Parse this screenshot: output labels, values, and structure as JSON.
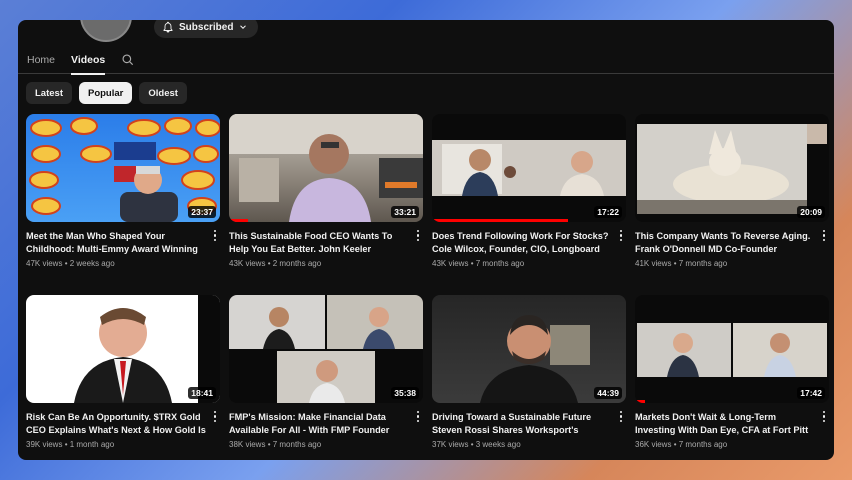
{
  "channel": {
    "subscribe_label": "Subscribed"
  },
  "tabs": [
    {
      "label": "Home"
    },
    {
      "label": "Videos"
    }
  ],
  "chips": [
    {
      "label": "Latest"
    },
    {
      "label": "Popular"
    },
    {
      "label": "Oldest"
    }
  ],
  "videos": [
    {
      "title": "Meet the Man Who Shaped Your Childhood: Multi-Emmy Award Winning CEO Andy...",
      "views": "47K views",
      "age": "2 weeks ago",
      "duration": "23:37"
    },
    {
      "title": "This Sustainable Food CEO Wants To Help You Eat Better. John Keeler Founder/CEO...",
      "views": "43K views",
      "age": "2 months ago",
      "duration": "33:21",
      "watched_fraction": 0.1
    },
    {
      "title": "Does Trend Following Work For Stocks? Cole Wilcox, Founder, CIO, Longboard Asset...",
      "views": "43K views",
      "age": "7 months ago",
      "duration": "17:22",
      "watched_fraction": 0.7
    },
    {
      "title": "This Company Wants To Reverse Aging. Frank O'Donnell MD Co-Founder Telomir...",
      "views": "41K views",
      "age": "7 months ago",
      "duration": "20:09"
    },
    {
      "title": "Risk Can Be An Opportunity. $TRX Gold CEO Explains What's Next & How Gold Is A...",
      "views": "39K views",
      "age": "1 month ago",
      "duration": "18:41"
    },
    {
      "title": "FMP's Mission: Make Financial Data Available For All - With FMP Founder and...",
      "views": "38K views",
      "age": "7 months ago",
      "duration": "35:38"
    },
    {
      "title": "Driving Toward a Sustainable Future Steven Rossi Shares Worksport's Mission",
      "views": "37K views",
      "age": "3 weeks ago",
      "duration": "44:39"
    },
    {
      "title": "Markets Don't Wait & Long-Term Investing With Dan Eye, CFA at Fort Pitt Capital Group",
      "views": "36K views",
      "age": "7 months ago",
      "duration": "17:42",
      "watched_fraction": 0.05
    }
  ],
  "colors": {
    "background": "#0f0f0f",
    "chip": "#272727",
    "chip_active": "#f1f1f1",
    "progress": "#ff0000",
    "secondary_text": "#aaaaaa"
  },
  "icons": {
    "subscribe": "bell-icon",
    "dropdown": "chevron-down-icon",
    "search": "search-icon",
    "more": "kebab-icon"
  }
}
